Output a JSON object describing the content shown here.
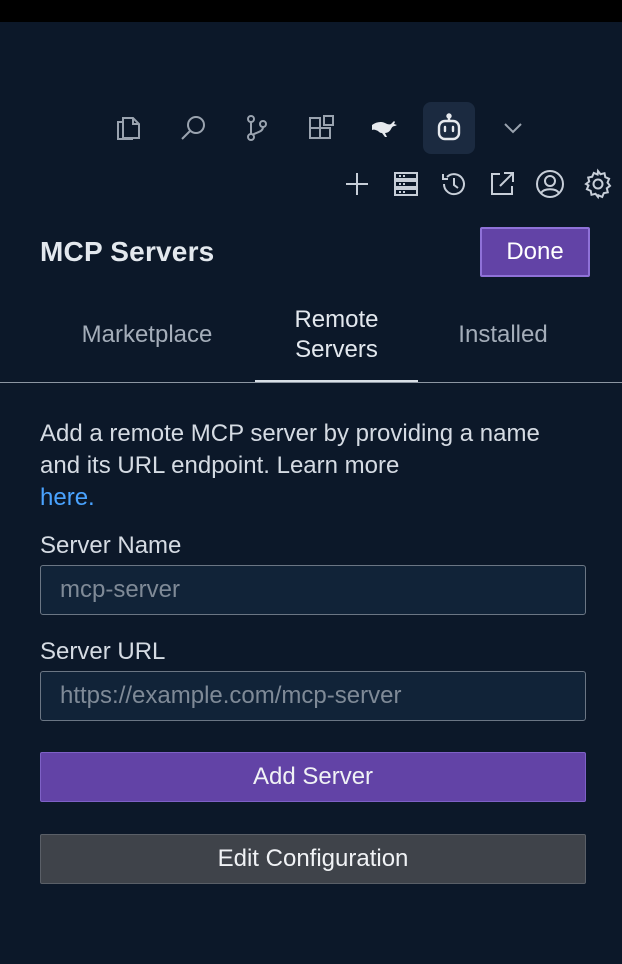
{
  "activity_bar": {
    "icons": [
      "explorer-icon",
      "search-icon",
      "source-control-icon",
      "extensions-icon",
      "kangaroo-icon",
      "robot-icon",
      "chevron-down-icon"
    ],
    "active": "robot-icon"
  },
  "toolbar": {
    "icons": [
      "plus-icon",
      "server-stack-icon",
      "history-icon",
      "open-external-icon",
      "account-icon",
      "gear-icon"
    ]
  },
  "panel": {
    "title": "MCP Servers",
    "done_label": "Done"
  },
  "tabs": [
    {
      "label": "Marketplace",
      "active": false
    },
    {
      "label": "Remote\nServers",
      "active": true
    },
    {
      "label": "Installed",
      "active": false
    }
  ],
  "remote": {
    "description": "Add a remote MCP server by providing a name and its URL endpoint. Learn more",
    "link_text": "here.",
    "server_name_label": "Server Name",
    "server_name_placeholder": "mcp-server",
    "server_url_label": "Server URL",
    "server_url_placeholder": "https://example.com/mcp-server",
    "add_button": "Add Server",
    "edit_button": "Edit Configuration"
  },
  "colors": {
    "background": "#0c1829",
    "accent": "#6243a6",
    "link": "#4aa3ff",
    "secondary_button": "#3f434a"
  }
}
